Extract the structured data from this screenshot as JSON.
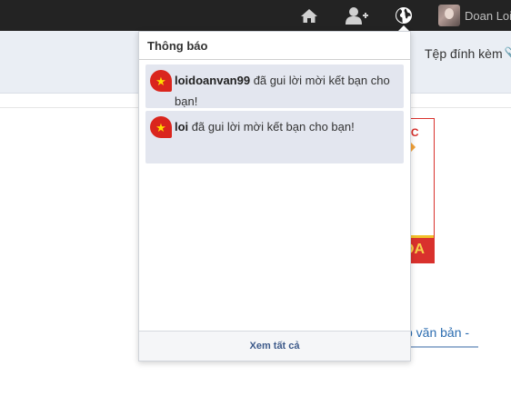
{
  "navbar": {
    "home_icon": "home-icon",
    "add_user_icon": "user-plus-icon",
    "globe_icon": "globe-icon",
    "username": "Doan Loi"
  },
  "background": {
    "attach_label": "Tệp đính kèm",
    "attach_icon": "📎",
    "ad_top_text": "ỌC",
    "ad_bottom_text": "OA",
    "link_text": "p văn bản -"
  },
  "notifications": {
    "title": "Thông báo",
    "items": [
      {
        "user": "loidoanvan99",
        "message": " đã gui lời mời kết bạn cho bạn!",
        "icon": "vietnam-flag-icon"
      },
      {
        "user": "loi",
        "message": " đã gui lời mời kết bạn cho bạn!",
        "icon": "vietnam-flag-icon"
      }
    ],
    "see_all": "Xem tất cả"
  },
  "colors": {
    "navbar_bg": "#232323",
    "item_bg": "#e3e6ef",
    "link": "#3d5a8a",
    "flag_red": "#da251d"
  }
}
